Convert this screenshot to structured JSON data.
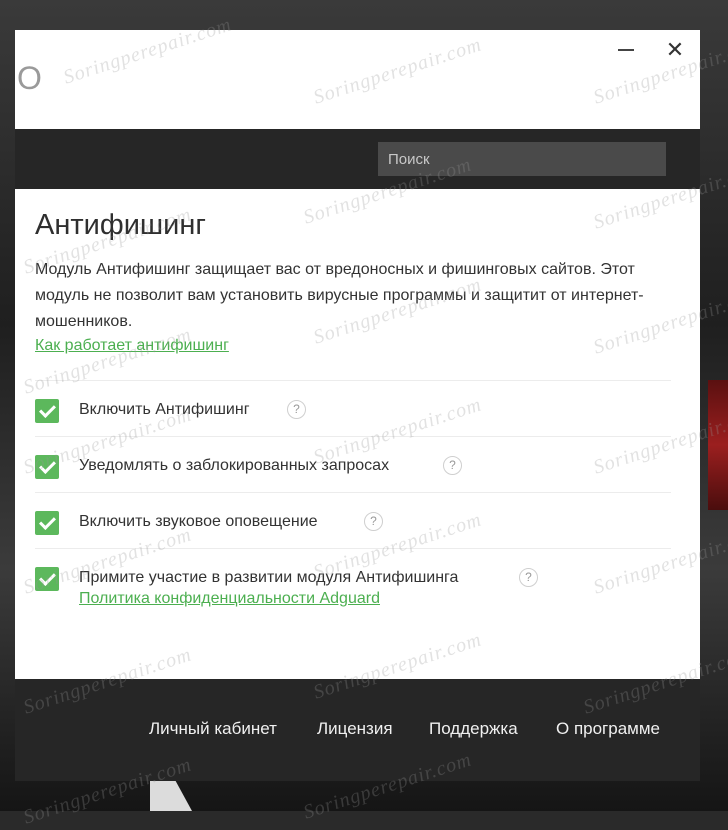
{
  "window": {
    "logo_fragment": "O",
    "minimize_label": "",
    "close_label": "✕"
  },
  "search": {
    "placeholder": "Поиск"
  },
  "page": {
    "title": "Антифишинг",
    "description": "Модуль Антифишинг защищает вас от вредоносных и фишинговых сайтов. Этот модуль не позволит вам установить вирусные программы и защитит от интернет-мошенников.",
    "how_link": "Как работает антифишинг"
  },
  "options": [
    {
      "label": "Включить Антифишинг",
      "checked": true,
      "help": "?"
    },
    {
      "label": "Уведомлять о заблокированных запросах",
      "checked": true,
      "help": "?"
    },
    {
      "label": "Включить звуковое оповещение",
      "checked": true,
      "help": "?"
    },
    {
      "label": "Примите участие в развитии модуля Антифишинга",
      "checked": true,
      "help": "?",
      "link": "Политика конфиденциальности Adguard"
    }
  ],
  "footer": {
    "links": [
      "Личный кабинет",
      "Лицензия",
      "Поддержка",
      "О программе"
    ]
  },
  "watermark": "Soringperepair.com",
  "colors": {
    "accent": "#5cb85c",
    "link": "#4caf50",
    "dark_bar": "#262626",
    "search_bg": "#4a4a4a"
  }
}
